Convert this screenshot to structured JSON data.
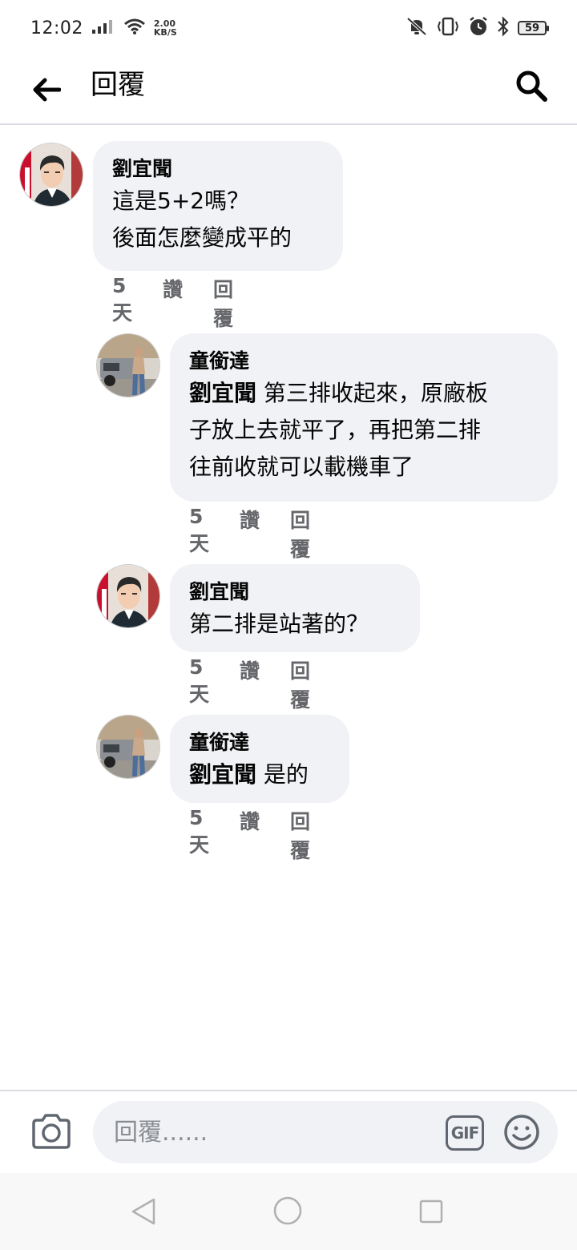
{
  "status_bar": {
    "time": "12:02",
    "speed_value": "2.00",
    "speed_unit": "KB/S",
    "battery": "59"
  },
  "header": {
    "title": "回覆"
  },
  "comments": [
    {
      "author": "劉宜聞",
      "lines": [
        "這是5+2嗎？",
        "後面怎麼變成平的"
      ],
      "time": "5天",
      "like": "讚",
      "reply": "回覆"
    },
    {
      "author": "童銜達",
      "mention": "劉宜聞",
      "lines": [
        " 第三排收起來，原廠板",
        "子放上去就平了，再把第二排",
        "往前收就可以載機車了"
      ],
      "time": "5天",
      "like": "讚",
      "reply": "回覆"
    },
    {
      "author": "劉宜聞",
      "lines": [
        "第二排是站著的？"
      ],
      "time": "5天",
      "like": "讚",
      "reply": "回覆"
    },
    {
      "author": "童銜達",
      "mention": "劉宜聞",
      "lines": [
        " 是的"
      ],
      "time": "5天",
      "like": "讚",
      "reply": "回覆"
    }
  ],
  "composer": {
    "placeholder": "回覆......",
    "gif_label": "GIF"
  },
  "icons": {
    "back": "arrow-left-icon",
    "search": "search-icon",
    "camera": "camera-icon",
    "emoji": "smiley-icon"
  }
}
